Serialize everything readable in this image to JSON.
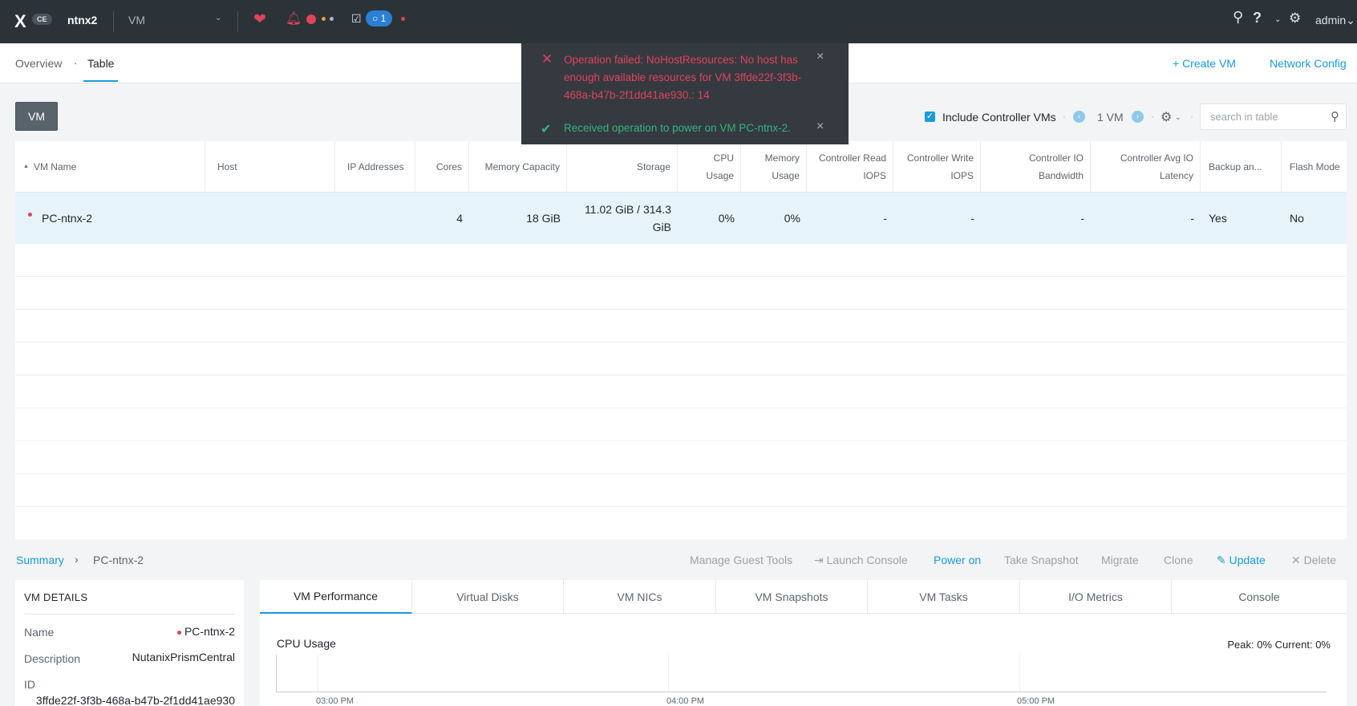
{
  "topbar": {
    "logo": "X",
    "badge": "CE",
    "cluster": "ntnx2",
    "view": "VM",
    "task_count": "1",
    "user": "admin"
  },
  "subnav": {
    "tabs": [
      "Overview",
      "Table"
    ],
    "separator": "·",
    "create_vm": "+ Create VM",
    "network_config": "Network Config"
  },
  "toast": {
    "error": "Operation failed: NoHostResources: No host has enough available resources for VM 3ffde22f-3f3b-468a-b47b-2f1dd41ae930.: 14",
    "success": "Received operation to power on VM PC-ntnx-2."
  },
  "toolbar": {
    "vm_button": "VM",
    "include_label": "Include Controller VMs",
    "vm_count": "1 VM",
    "search_placeholder": "search in table"
  },
  "table": {
    "columns": [
      "VM Name",
      "Host",
      "IP Addresses",
      "Cores",
      "Memory Capacity",
      "Storage",
      "CPU Usage",
      "Memory Usage",
      "Controller Read IOPS",
      "Controller Write IOPS",
      "Controller IO Bandwidth",
      "Controller Avg IO Latency",
      "Backup an...",
      "Flash Mode"
    ],
    "rows": [
      [
        "PC-ntnx-2",
        "",
        "",
        "4",
        "18 GiB",
        "11.02 GiB / 314.3 GiB",
        "0%",
        "0%",
        "-",
        "-",
        "-",
        "-",
        "Yes",
        "No"
      ]
    ]
  },
  "details_bar": {
    "summary": "Summary",
    "crumb_sep": "›",
    "vm_name": "PC-ntnx-2",
    "actions": {
      "manage_guest_tools": "Manage Guest Tools",
      "launch_console": "Launch Console",
      "power_on": "Power on",
      "take_snapshot": "Take Snapshot",
      "migrate": "Migrate",
      "clone": "Clone",
      "update": "Update",
      "delete": "Delete"
    }
  },
  "vm_details": {
    "title": "VM DETAILS",
    "name_label": "Name",
    "name_value": "PC-ntnx-2",
    "description_label": "Description",
    "description_value": "NutanixPrismCentral",
    "id_label": "ID",
    "id_value": "3ffde22f-3f3b-468a-b47b-2f1dd41ae930"
  },
  "perf": {
    "tabs": [
      "VM Performance",
      "Virtual Disks",
      "VM NICs",
      "VM Snapshots",
      "VM Tasks",
      "I/O Metrics",
      "Console"
    ],
    "chart_title": "CPU Usage",
    "chart_stats": "Peak: 0%  Current: 0%",
    "time_labels": [
      "03:00 PM",
      "04:00 PM",
      "05:00 PM"
    ]
  },
  "colors": {
    "topbar": "#2b3238",
    "accent": "#1b9bd8",
    "error": "#e0435a",
    "success": "#36b37e",
    "selected_row": "#e6f3fb"
  }
}
